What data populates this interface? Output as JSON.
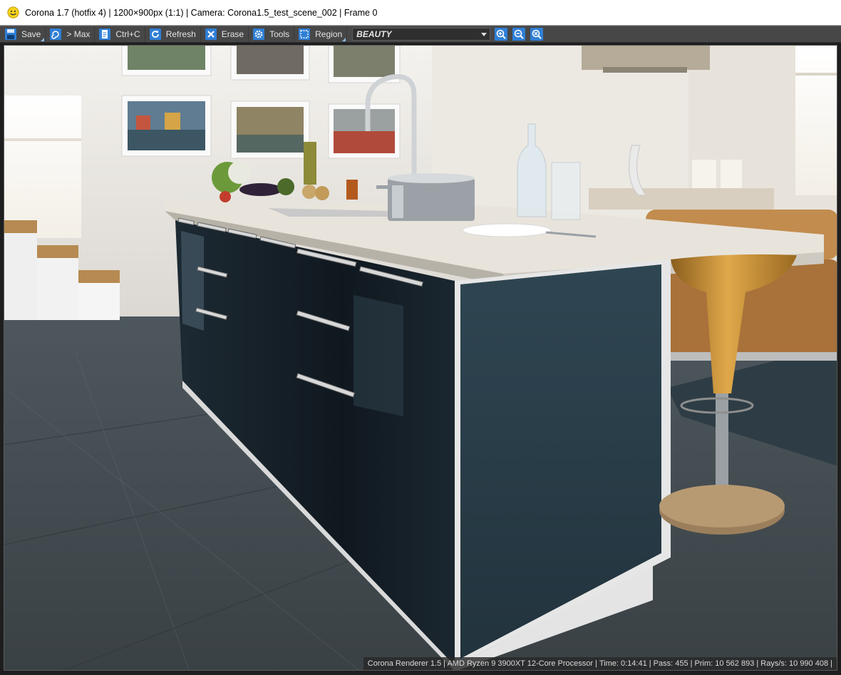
{
  "window": {
    "title": "Corona 1.7 (hotfix 4) | 1200×900px (1:1) | Camera: Corona1.5_test_scene_002 | Frame 0",
    "app_icon": "smiley-icon"
  },
  "toolbar": {
    "save_label": "Save",
    "max_label": "> Max",
    "copy_label": "Ctrl+C",
    "refresh_label": "Refresh",
    "erase_label": "Erase",
    "tools_label": "Tools",
    "region_label": "Region",
    "render_pass": "BEAUTY",
    "icons": {
      "save": "floppy-icon",
      "max": "spiral-icon",
      "copy": "clipboard-icon",
      "refresh": "refresh-icon",
      "erase": "erase-x-icon",
      "tools": "gear-icon",
      "region": "region-select-icon",
      "zoom_in": "zoom-in-icon",
      "zoom_out": "zoom-out-icon",
      "zoom_fit": "zoom-fit-icon"
    },
    "accent_color": "#2f7fd6"
  },
  "viewport": {
    "image_subject": "rendered kitchen interior"
  },
  "status": {
    "text": "Corona Renderer 1.5 | AMD Ryzen 9 3900XT 12-Core Processor  | Time: 0:14:41 | Pass: 455 | Prim: 10 562 893 | Rays/s: 10 990 408 |"
  }
}
